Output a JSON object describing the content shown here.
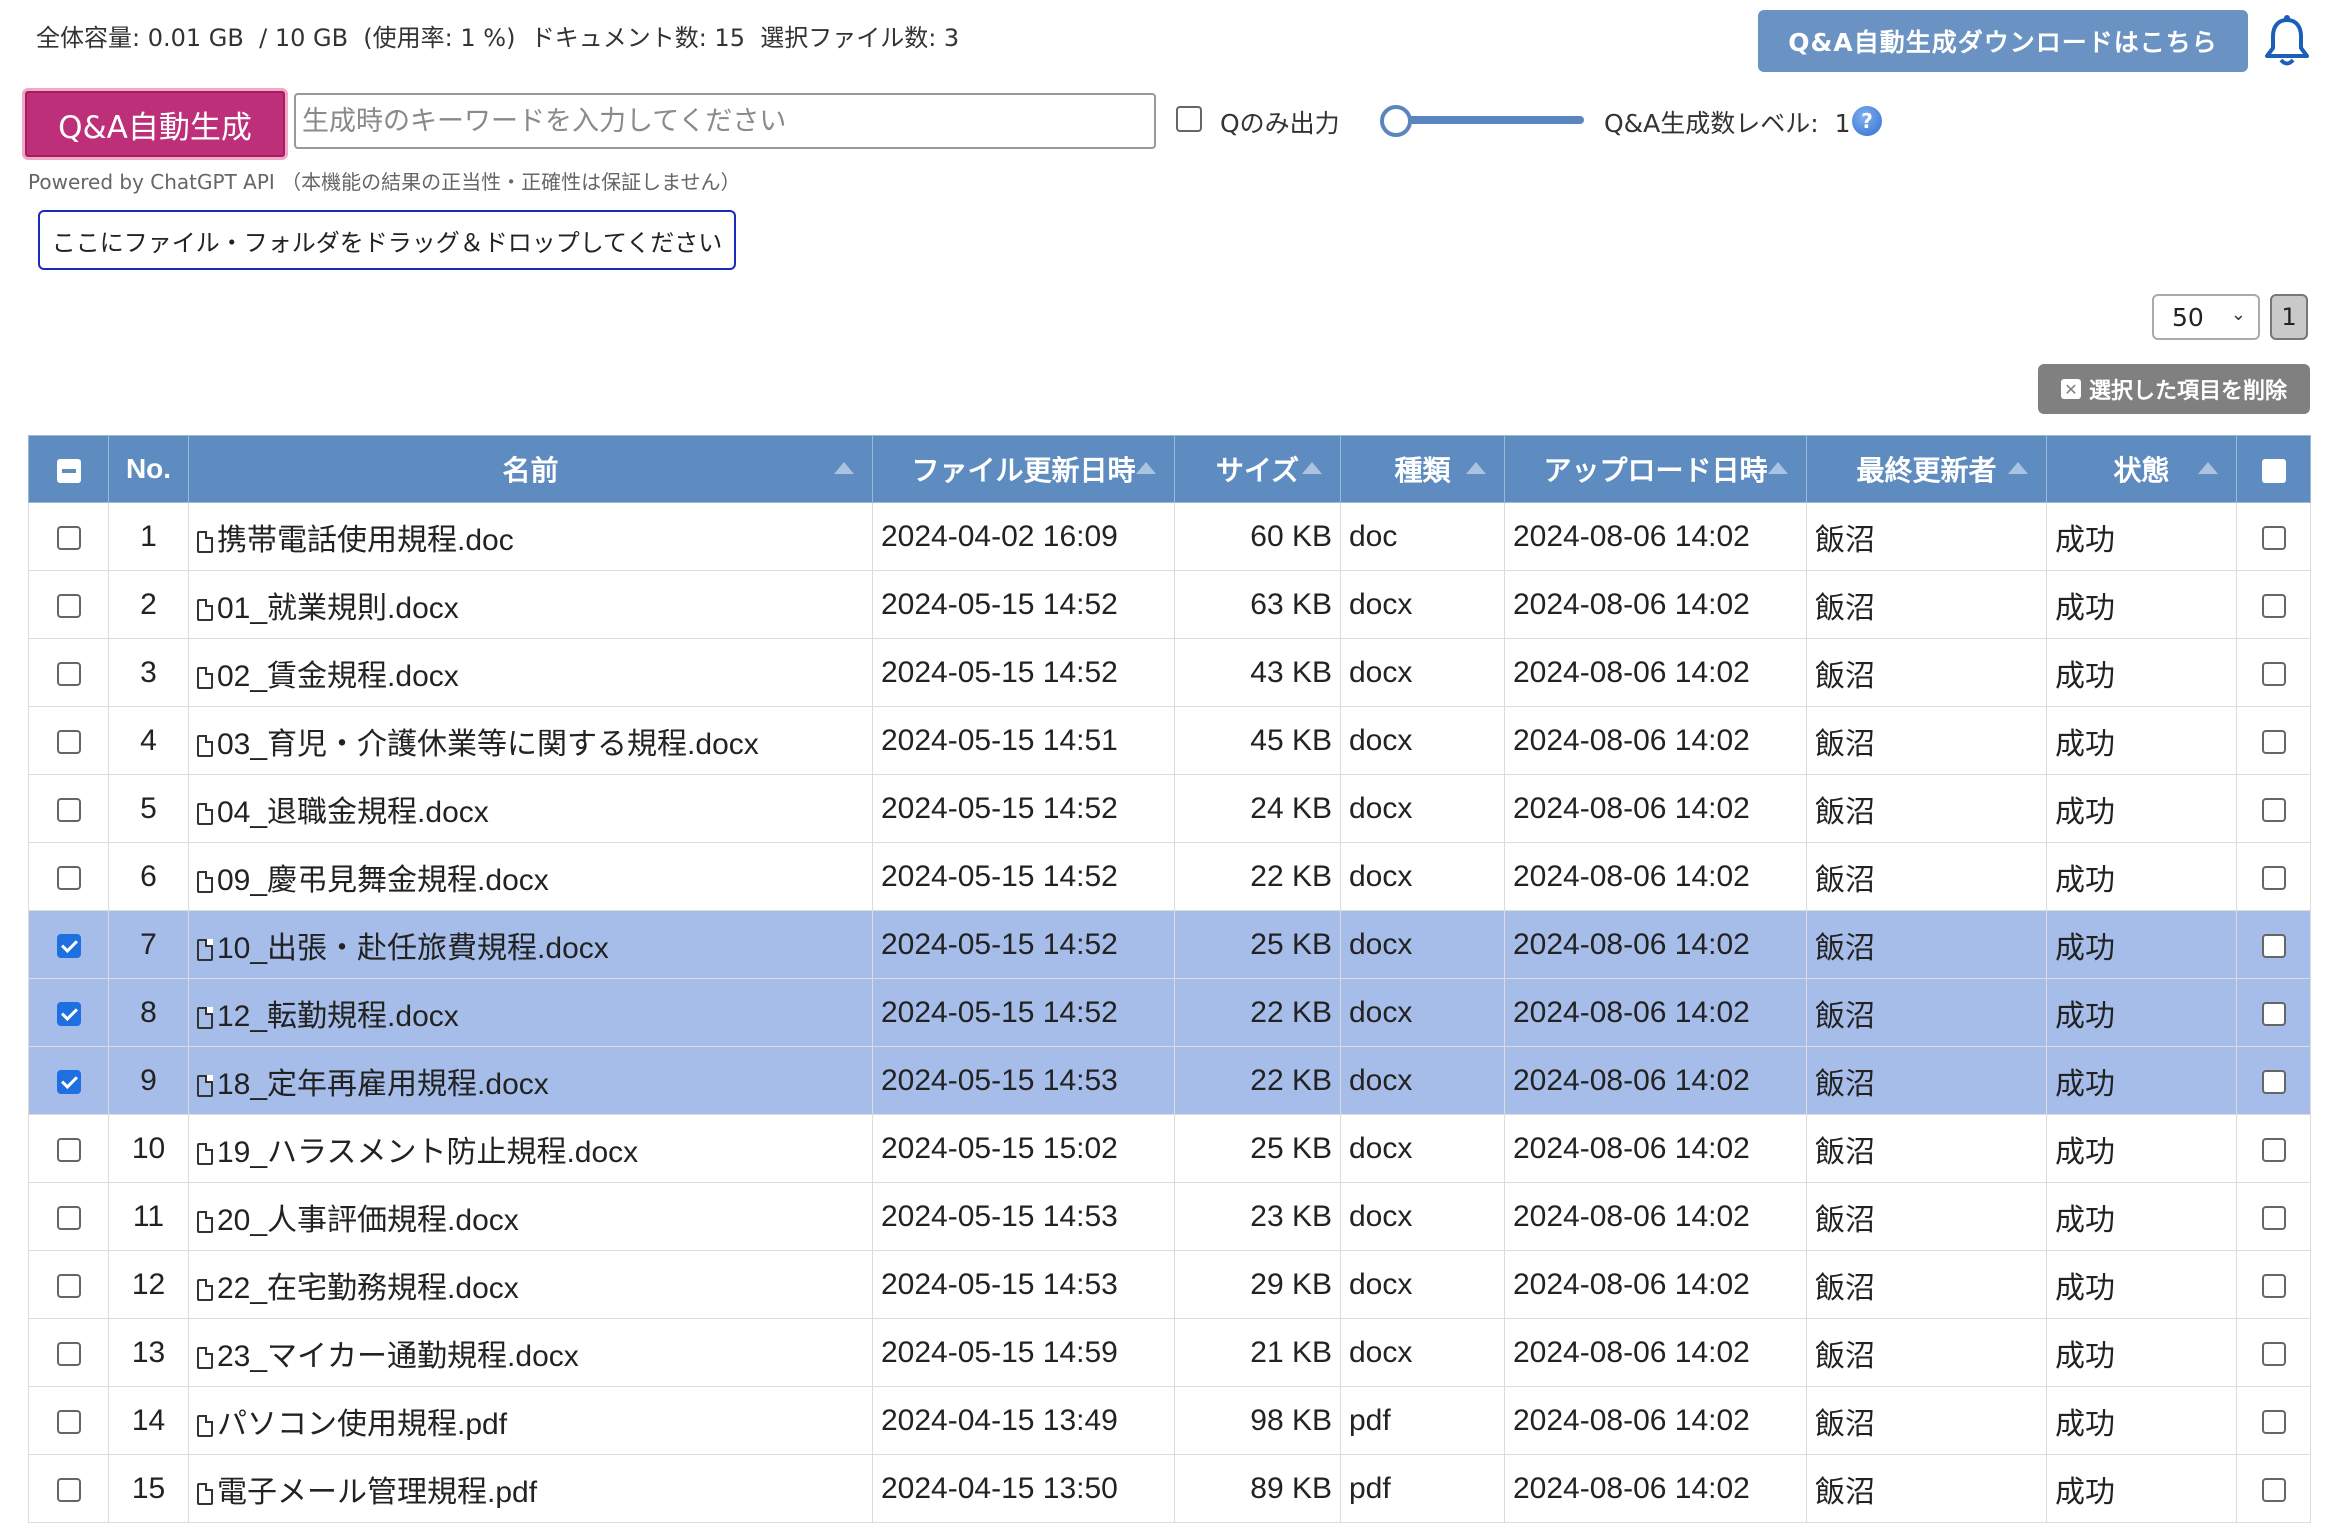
{
  "header": {
    "stats": "全体容量: 0.01 GB  / 10 GB  (使用率: 1 %)  ドキュメント数: 15  選択ファイル数: 3",
    "download_button": "Q&A自動生成ダウンロードはこちら",
    "bell_icon": "bell-icon"
  },
  "generator": {
    "button_label": "Q&A自動生成",
    "keyword_placeholder": "生成時のキーワードを入力してください",
    "keyword_value": "",
    "q_only_label": "Qのみ出力",
    "q_only_checked": false,
    "level_label": "Q&A生成数レベル:  1",
    "level_value": 1,
    "help_icon_glyph": "?",
    "powered_by": "Powered by ChatGPT API （本機能の結果の正当性・正確性は保証しません）"
  },
  "drop_zone": {
    "label": "ここにファイル・フォルダをドラッグ＆ドロップしてください"
  },
  "pagination": {
    "page_size": "50",
    "current_page": "1"
  },
  "actions": {
    "delete_selected": "選択した項目を削除"
  },
  "table": {
    "columns": [
      "No.",
      "名前",
      "ファイル更新日時",
      "サイズ",
      "種類",
      "アップロード日時",
      "最終更新者",
      "状態"
    ],
    "rows": [
      {
        "selected": false,
        "no": "1",
        "name": "携帯電話使用規程.doc",
        "modified": "2024-04-02 16:09",
        "size": "60 KB",
        "type": "doc",
        "uploaded": "2024-08-06 14:02",
        "updater": "飯沼",
        "status": "成功"
      },
      {
        "selected": false,
        "no": "2",
        "name": "01_就業規則.docx",
        "modified": "2024-05-15 14:52",
        "size": "63 KB",
        "type": "docx",
        "uploaded": "2024-08-06 14:02",
        "updater": "飯沼",
        "status": "成功"
      },
      {
        "selected": false,
        "no": "3",
        "name": "02_賃金規程.docx",
        "modified": "2024-05-15 14:52",
        "size": "43 KB",
        "type": "docx",
        "uploaded": "2024-08-06 14:02",
        "updater": "飯沼",
        "status": "成功"
      },
      {
        "selected": false,
        "no": "4",
        "name": "03_育児・介護休業等に関する規程.docx",
        "modified": "2024-05-15 14:51",
        "size": "45 KB",
        "type": "docx",
        "uploaded": "2024-08-06 14:02",
        "updater": "飯沼",
        "status": "成功"
      },
      {
        "selected": false,
        "no": "5",
        "name": "04_退職金規程.docx",
        "modified": "2024-05-15 14:52",
        "size": "24 KB",
        "type": "docx",
        "uploaded": "2024-08-06 14:02",
        "updater": "飯沼",
        "status": "成功"
      },
      {
        "selected": false,
        "no": "6",
        "name": "09_慶弔見舞金規程.docx",
        "modified": "2024-05-15 14:52",
        "size": "22 KB",
        "type": "docx",
        "uploaded": "2024-08-06 14:02",
        "updater": "飯沼",
        "status": "成功"
      },
      {
        "selected": true,
        "no": "7",
        "name": "10_出張・赴任旅費規程.docx",
        "modified": "2024-05-15 14:52",
        "size": "25 KB",
        "type": "docx",
        "uploaded": "2024-08-06 14:02",
        "updater": "飯沼",
        "status": "成功"
      },
      {
        "selected": true,
        "no": "8",
        "name": "12_転勤規程.docx",
        "modified": "2024-05-15 14:52",
        "size": "22 KB",
        "type": "docx",
        "uploaded": "2024-08-06 14:02",
        "updater": "飯沼",
        "status": "成功"
      },
      {
        "selected": true,
        "no": "9",
        "name": "18_定年再雇用規程.docx",
        "modified": "2024-05-15 14:53",
        "size": "22 KB",
        "type": "docx",
        "uploaded": "2024-08-06 14:02",
        "updater": "飯沼",
        "status": "成功"
      },
      {
        "selected": false,
        "no": "10",
        "name": "19_ハラスメント防止規程.docx",
        "modified": "2024-05-15 15:02",
        "size": "25 KB",
        "type": "docx",
        "uploaded": "2024-08-06 14:02",
        "updater": "飯沼",
        "status": "成功"
      },
      {
        "selected": false,
        "no": "11",
        "name": "20_人事評価規程.docx",
        "modified": "2024-05-15 14:53",
        "size": "23 KB",
        "type": "docx",
        "uploaded": "2024-08-06 14:02",
        "updater": "飯沼",
        "status": "成功"
      },
      {
        "selected": false,
        "no": "12",
        "name": "22_在宅勤務規程.docx",
        "modified": "2024-05-15 14:53",
        "size": "29 KB",
        "type": "docx",
        "uploaded": "2024-08-06 14:02",
        "updater": "飯沼",
        "status": "成功"
      },
      {
        "selected": false,
        "no": "13",
        "name": "23_マイカー通勤規程.docx",
        "modified": "2024-05-15 14:59",
        "size": "21 KB",
        "type": "docx",
        "uploaded": "2024-08-06 14:02",
        "updater": "飯沼",
        "status": "成功"
      },
      {
        "selected": false,
        "no": "14",
        "name": "パソコン使用規程.pdf",
        "modified": "2024-04-15 13:49",
        "size": "98 KB",
        "type": "pdf",
        "uploaded": "2024-08-06 14:02",
        "updater": "飯沼",
        "status": "成功"
      },
      {
        "selected": false,
        "no": "15",
        "name": "電子メール管理規程.pdf",
        "modified": "2024-04-15 13:50",
        "size": "89 KB",
        "type": "pdf",
        "uploaded": "2024-08-06 14:02",
        "updater": "飯沼",
        "status": "成功"
      }
    ]
  },
  "colors": {
    "header_blue": "#5e8cc0",
    "selected_row": "#a6bde9",
    "generate_pink": "#be2f7a",
    "delete_gray": "#808080"
  }
}
